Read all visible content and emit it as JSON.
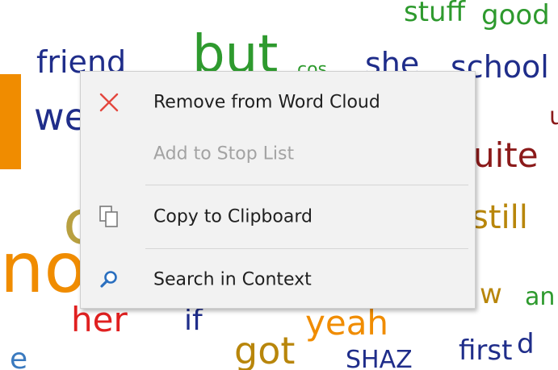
{
  "word_cloud": {
    "words": [
      {
        "text": "friend",
        "color": "#1f2d8a"
      },
      {
        "text": "but",
        "color": "#2e9a2e"
      },
      {
        "text": "cos",
        "color": "#2e9a2e"
      },
      {
        "text": "she",
        "color": "#1f2d8a"
      },
      {
        "text": "school",
        "color": "#1f2d8a"
      },
      {
        "text": "we",
        "color": "#1f2d8a"
      },
      {
        "text": "uite",
        "color": "#8b1a1a"
      },
      {
        "text": "still",
        "color": "#b8860b"
      },
      {
        "text": "w",
        "color": "#b8860b"
      },
      {
        "text": "an",
        "color": "#2e9a2e"
      },
      {
        "text": "her",
        "color": "#e02020"
      },
      {
        "text": "if",
        "color": "#1f2d8a"
      },
      {
        "text": "yeah",
        "color": "#f08c00"
      },
      {
        "text": "got",
        "color": "#b8860b"
      },
      {
        "text": "first",
        "color": "#1f2d8a"
      },
      {
        "text": "d",
        "color": "#1f2d8a"
      },
      {
        "text": "no",
        "color": "#3a7abf"
      },
      {
        "text": "e",
        "color": "#f08c00"
      },
      {
        "text": "good",
        "color": "#2e9a2e"
      },
      {
        "text": "stuff",
        "color": "#2e9a2e"
      },
      {
        "text": "u",
        "color": "#8b1a1a"
      },
      {
        "text": "SHAZ",
        "color": "#1f2d8a"
      }
    ]
  },
  "context_menu": {
    "items": [
      {
        "label": "Remove from Word Cloud",
        "icon": "close-icon",
        "enabled": true
      },
      {
        "label": "Add to Stop List",
        "icon": "",
        "enabled": false
      },
      {
        "label": "Copy to Clipboard",
        "icon": "copy-icon",
        "enabled": true
      },
      {
        "label": "Search in Context",
        "icon": "search-icon",
        "enabled": true
      }
    ],
    "colors": {
      "icon_red": "#e4473e",
      "icon_blue": "#2a6fbf",
      "icon_gray": "#7a7a7a"
    }
  }
}
